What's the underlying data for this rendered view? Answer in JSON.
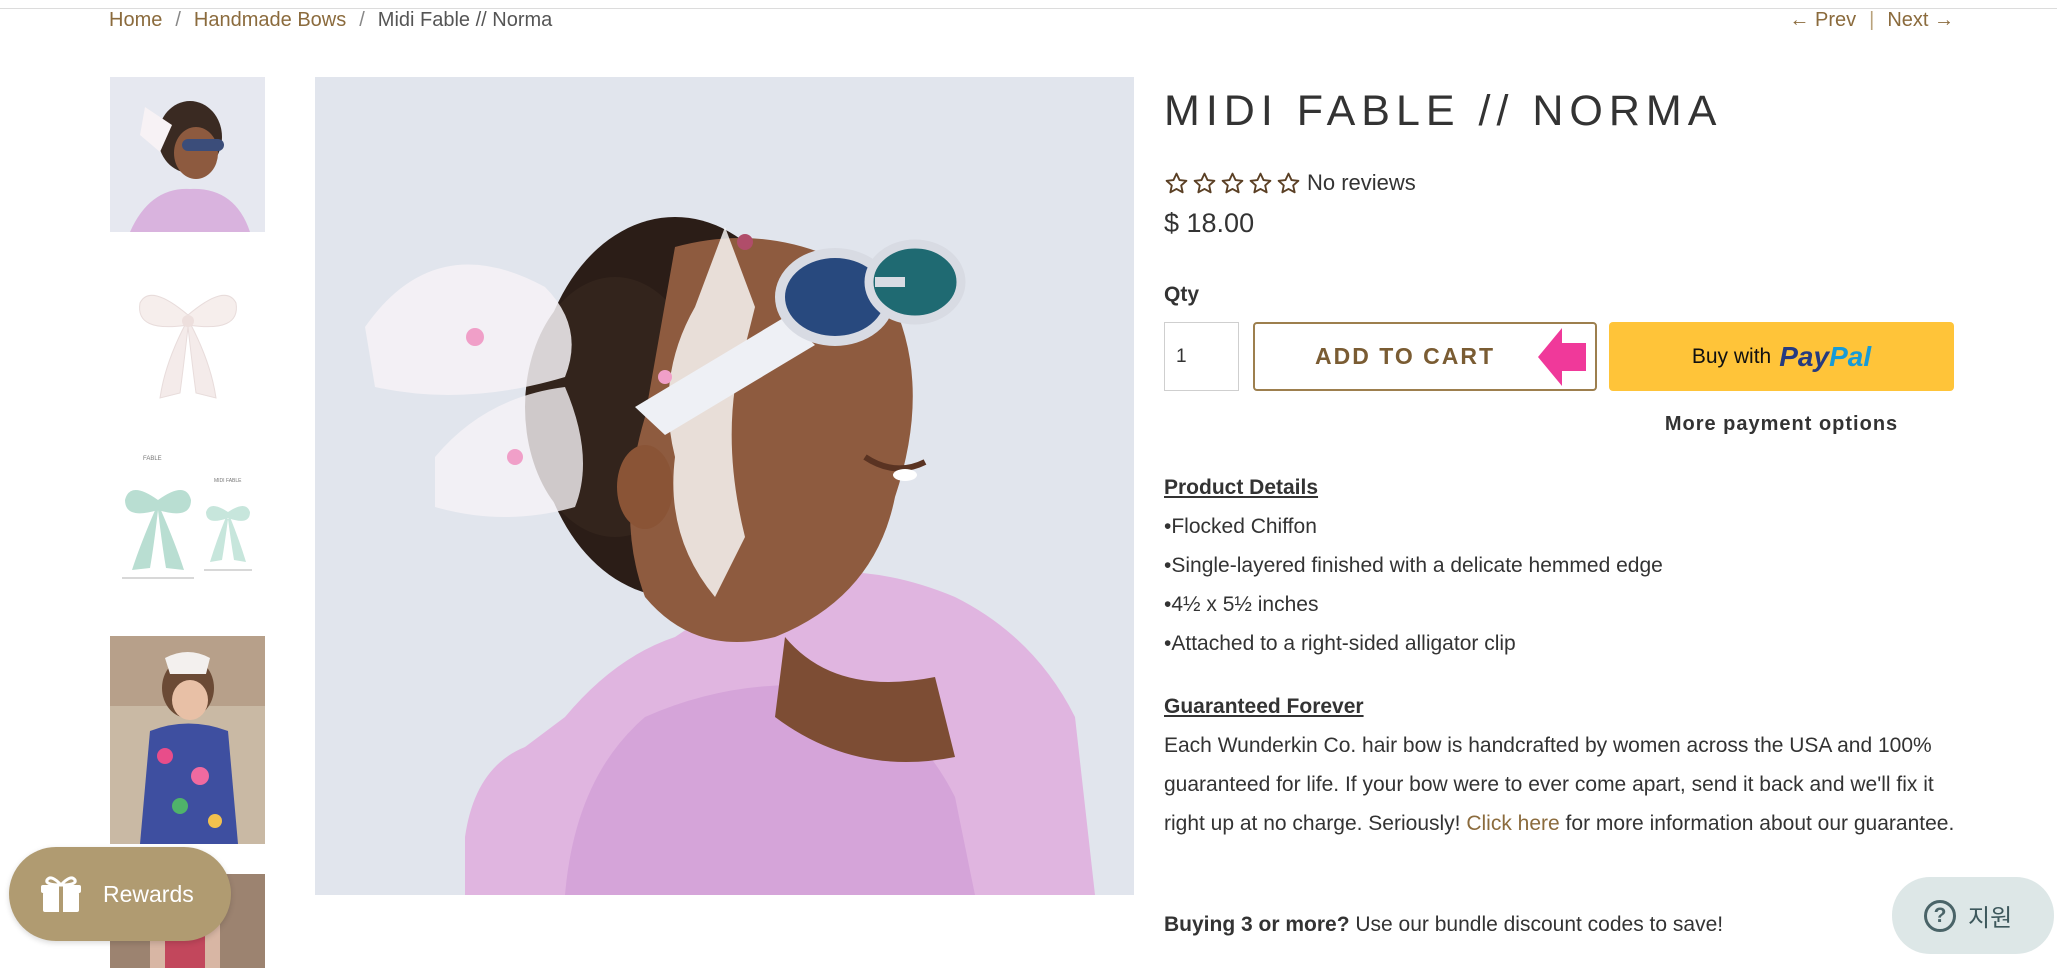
{
  "breadcrumb": {
    "items": [
      "Home",
      "Handmade Bows",
      "Midi Fable // Norma"
    ],
    "separator": "/"
  },
  "pager": {
    "prev": "← Prev",
    "divider": "|",
    "next": "Next →"
  },
  "gallery": {
    "thumbnails": [
      "photo-girl-sunglasses",
      "photo-white-bow",
      "size-diagram-fable-midi-fable",
      "photo-toddler-floral-dress",
      "photo-partial"
    ],
    "thumb_3_labels": {
      "left_title": "FABLE",
      "right_title": "MIDI FABLE"
    }
  },
  "product": {
    "title": "MIDI FABLE // NORMA",
    "rating": {
      "stars_filled": 0,
      "stars_total": 5,
      "reviews_text": "No reviews"
    },
    "price": "$ 18.00",
    "qty_label": "Qty",
    "qty_value": "1",
    "add_to_cart": "ADD TO CART",
    "paypal": {
      "buy_with": "Buy with",
      "logo_pay": "Pay",
      "logo_pal": "Pal"
    },
    "more_payment": "More payment options"
  },
  "description": {
    "details_heading": "Product Details",
    "bullets": [
      "•Flocked Chiffon",
      "•Single-layered finished with a delicate hemmed edge",
      "•4½ x 5½ inches",
      "•Attached to a right-sided alligator clip"
    ],
    "guarantee_heading": "Guaranteed Forever",
    "guarantee_before": "Each Wunderkin Co. hair bow is handcrafted by women across the USA and 100% guaranteed for life. If your bow were to ever come apart, send it back and we'll fix it right up at no charge. Seriously! ",
    "guarantee_link": "Click here",
    "guarantee_after": " for more information about our guarantee.",
    "bundle_bold": "Buying 3 or more?",
    "bundle_text": " Use our bundle discount codes to save!"
  },
  "widgets": {
    "rewards_label": "Rewards",
    "support_label": "지원"
  },
  "colors": {
    "accent": "#8b6b3d",
    "paypal_yellow": "#ffc439",
    "rewards_bg": "#b09b71",
    "annotation_arrow": "#f0399a"
  },
  "icons": [
    "star-outline-icon",
    "gift-icon",
    "help-circle-icon",
    "pink-arrow-annotation"
  ]
}
